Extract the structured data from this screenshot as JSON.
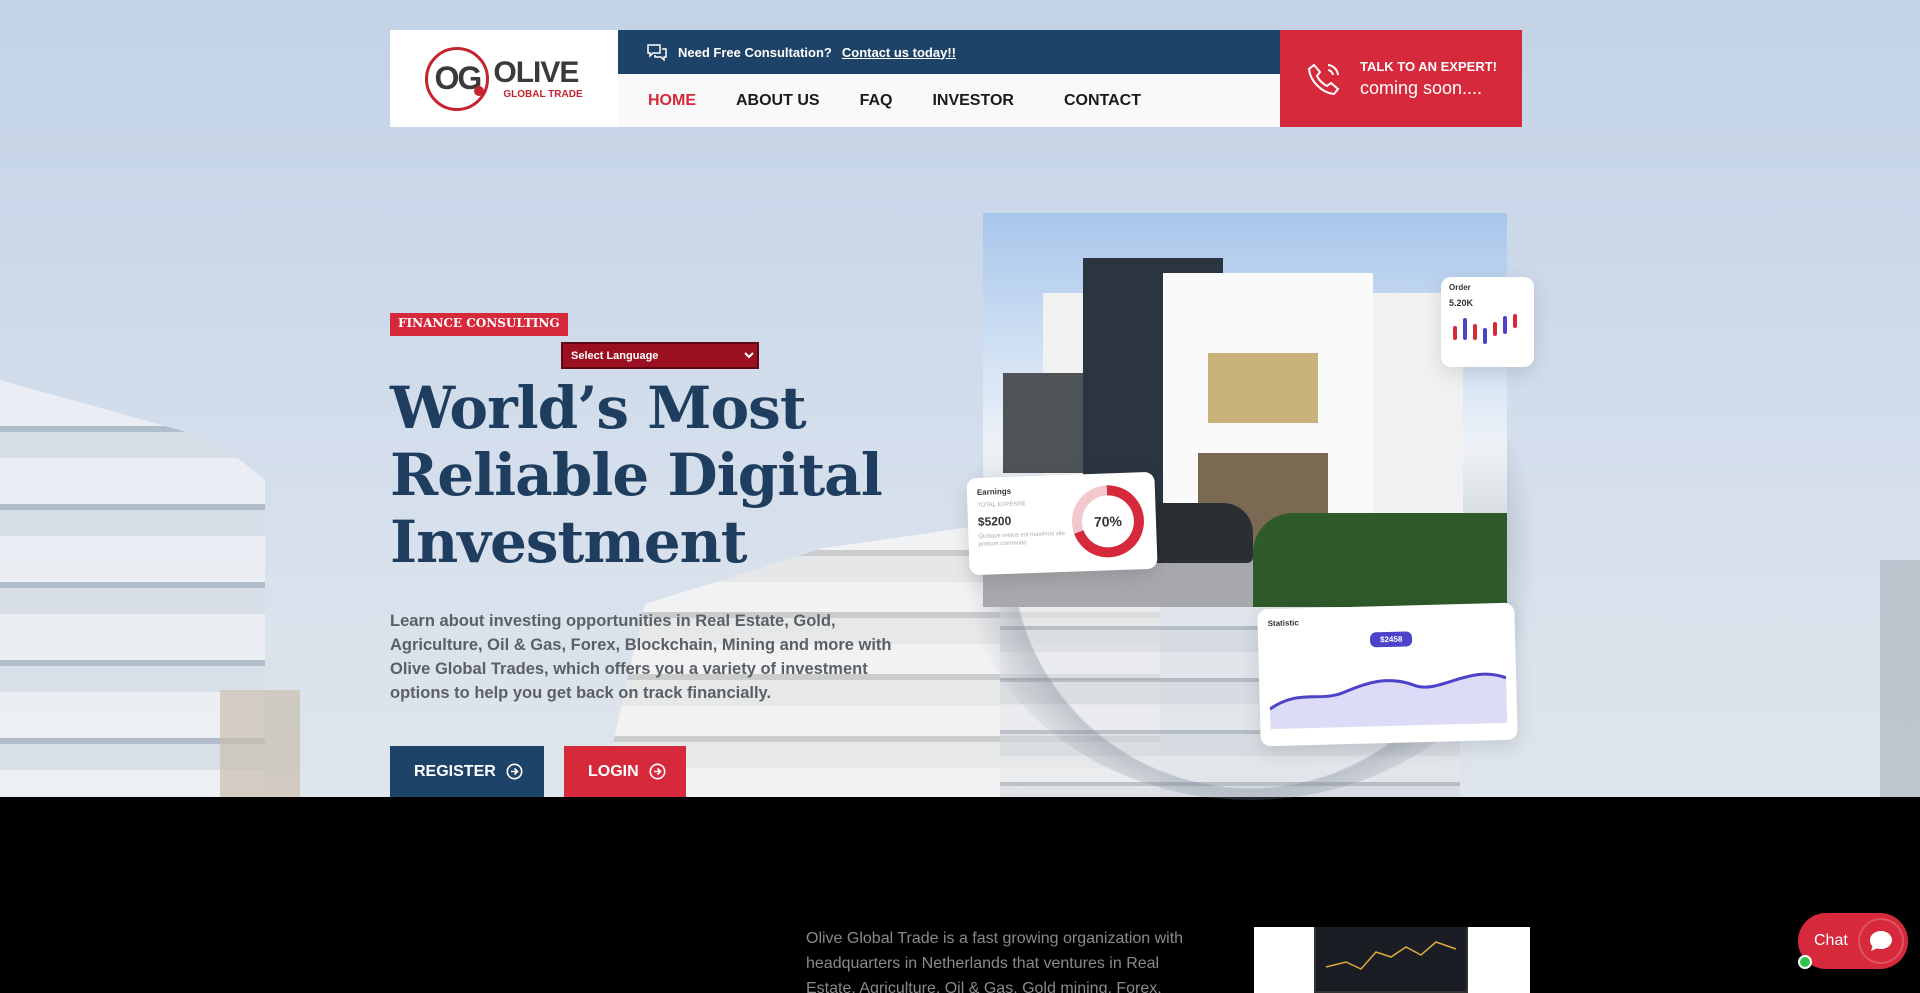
{
  "header": {
    "logo": {
      "mark": "OG",
      "word": "OLIVE",
      "sub": "GLOBAL TRADE"
    },
    "topbar": {
      "text": "Need Free Consultation?",
      "link": "Contact us today!!",
      "icon": "chat-icon"
    },
    "menu": [
      {
        "label": "HOME",
        "active": true
      },
      {
        "label": "ABOUT US",
        "active": false
      },
      {
        "label": "FAQ",
        "active": false
      },
      {
        "label": "INVESTOR",
        "active": false
      },
      {
        "label": "CONTACT",
        "active": false
      }
    ],
    "cta": {
      "small": "TALK TO AN EXPERT!",
      "big": "coming soon....",
      "icon": "phone-icon"
    }
  },
  "hero": {
    "badge": "FINANCE CONSULTING",
    "language_select": {
      "selected": "Select Language"
    },
    "headline": "World’s Most Reliable Digital Investment",
    "description": "Learn about investing opportunities in Real Estate, Gold, Agriculture, Oil & Gas, Forex, Blockchain, Mining and more with Olive Global Trades, which offers you a variety of investment options to help you get back on track financially.",
    "register_label": "REGISTER",
    "login_label": "LOGIN",
    "cards": {
      "earnings": {
        "title": "Earnings",
        "sub": "TOTAL EXPENSE",
        "value": "$5200",
        "note": "Quisque metus est maximus vite pretium commodo",
        "percent": "70%",
        "fill": 0.7
      },
      "order": {
        "title": "Order",
        "value": "5.20K"
      },
      "statistic": {
        "title": "Statistic",
        "tag": "$2458"
      }
    }
  },
  "about": {
    "text": "Olive Global Trade is a fast growing organization with headquarters in Netherlands that ventures in Real Estate, Agriculture, Oil & Gas, Gold mining, Forex,"
  },
  "chat": {
    "label": "Chat"
  },
  "colors": {
    "brand_red": "#d6293b",
    "brand_navy": "#1e4369"
  }
}
